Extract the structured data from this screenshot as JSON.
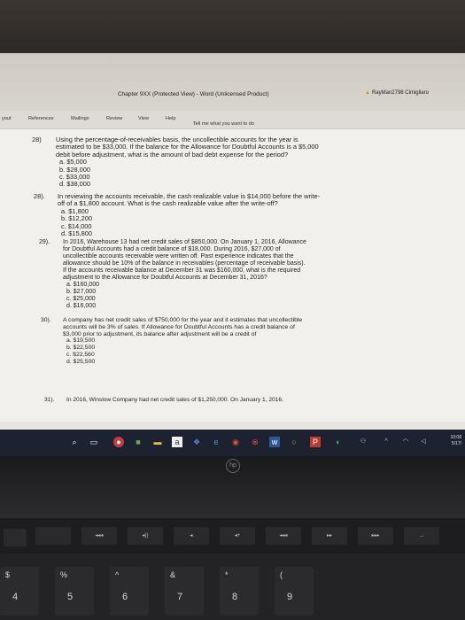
{
  "window": {
    "title": "Chapter 9XX (Protected View)  -  Word (Unlicensed Product)",
    "user": "RayMan2798 Cimigliaro"
  },
  "ribbon": {
    "layout": "yout",
    "references": "References",
    "mailings": "Mailings",
    "review": "Review",
    "view": "View",
    "help": "Help",
    "tell_me": "Tell me what you want to do"
  },
  "questions": [
    {
      "number": "28)",
      "lines": [
        "Using the percentage-of-receivables basis, the uncollectible accounts for the year is",
        "estimated to be $33,000. If the balance for the Allowance for Doubtful Accounts is a $5,000",
        "debit before adjustment, what is the amount of bad debt expense for the period?"
      ],
      "options": [
        "a.  $5,000",
        "b.  $28,000",
        "c.  $33,000",
        "d.  $38,000"
      ]
    },
    {
      "number": "28).",
      "lines": [
        "In reviewing the accounts receivable, the cash realizable value is $14,000 before the write-",
        "off of a $1,800 account. What is the cash realizable value after the write-off?"
      ],
      "options": [
        "a.  $1,800",
        "b.  $12,200",
        "c.  $14,000",
        "d.  $15,800"
      ]
    },
    {
      "number": "29).",
      "lines": [
        "In 2016, Warehouse 13 had net credit sales of $850,000. On January 1, 2016, Allowance",
        "for Doubtful Accounts had a credit balance of $18,000. During 2016, $27,000 of",
        "uncollectible accounts receivable were written off. Past experience indicates that the",
        "allowance should be 10% of the balance in receivables (percentage of receivable basis).",
        "If the accounts receivable balance at December 31 was $160,000, what is the required",
        "adjustment to the Allowance for Doubtful Accounts at December 31, 2016?"
      ],
      "options": [
        "a.  $160,000",
        "b.  $27,000",
        "c.  $25,000",
        "d.  $16,000"
      ]
    },
    {
      "number": "30).",
      "lines": [
        "A company has net credit sales of $750,000 for the year and it estimates that uncollectible",
        "accounts will be 3% of sales. If Allowance for Doubtful Accounts has a credit balance of",
        "$3,000 prior to adjustment, its balance after adjustment will be a credit of"
      ],
      "options": [
        "a.  $19,500",
        "b.  $22,500",
        "c.  $22,560",
        "d.  $25,500"
      ]
    },
    {
      "number": "31).",
      "lines": [
        "In 2016, Winslow Company had net credit sales of $1,250,000. On January 1, 2016,"
      ],
      "options": []
    }
  ],
  "taskbar": {
    "time": "10:08",
    "date": "5/17/"
  },
  "keyboard": {
    "num_keys": [
      {
        "shift": "$",
        "num": "4"
      },
      {
        "shift": "%",
        "num": "5"
      },
      {
        "shift": "^",
        "num": "6"
      },
      {
        "shift": "&",
        "num": "7"
      },
      {
        "shift": "*",
        "num": "8"
      },
      {
        "shift": "(",
        "num": "9"
      }
    ]
  }
}
